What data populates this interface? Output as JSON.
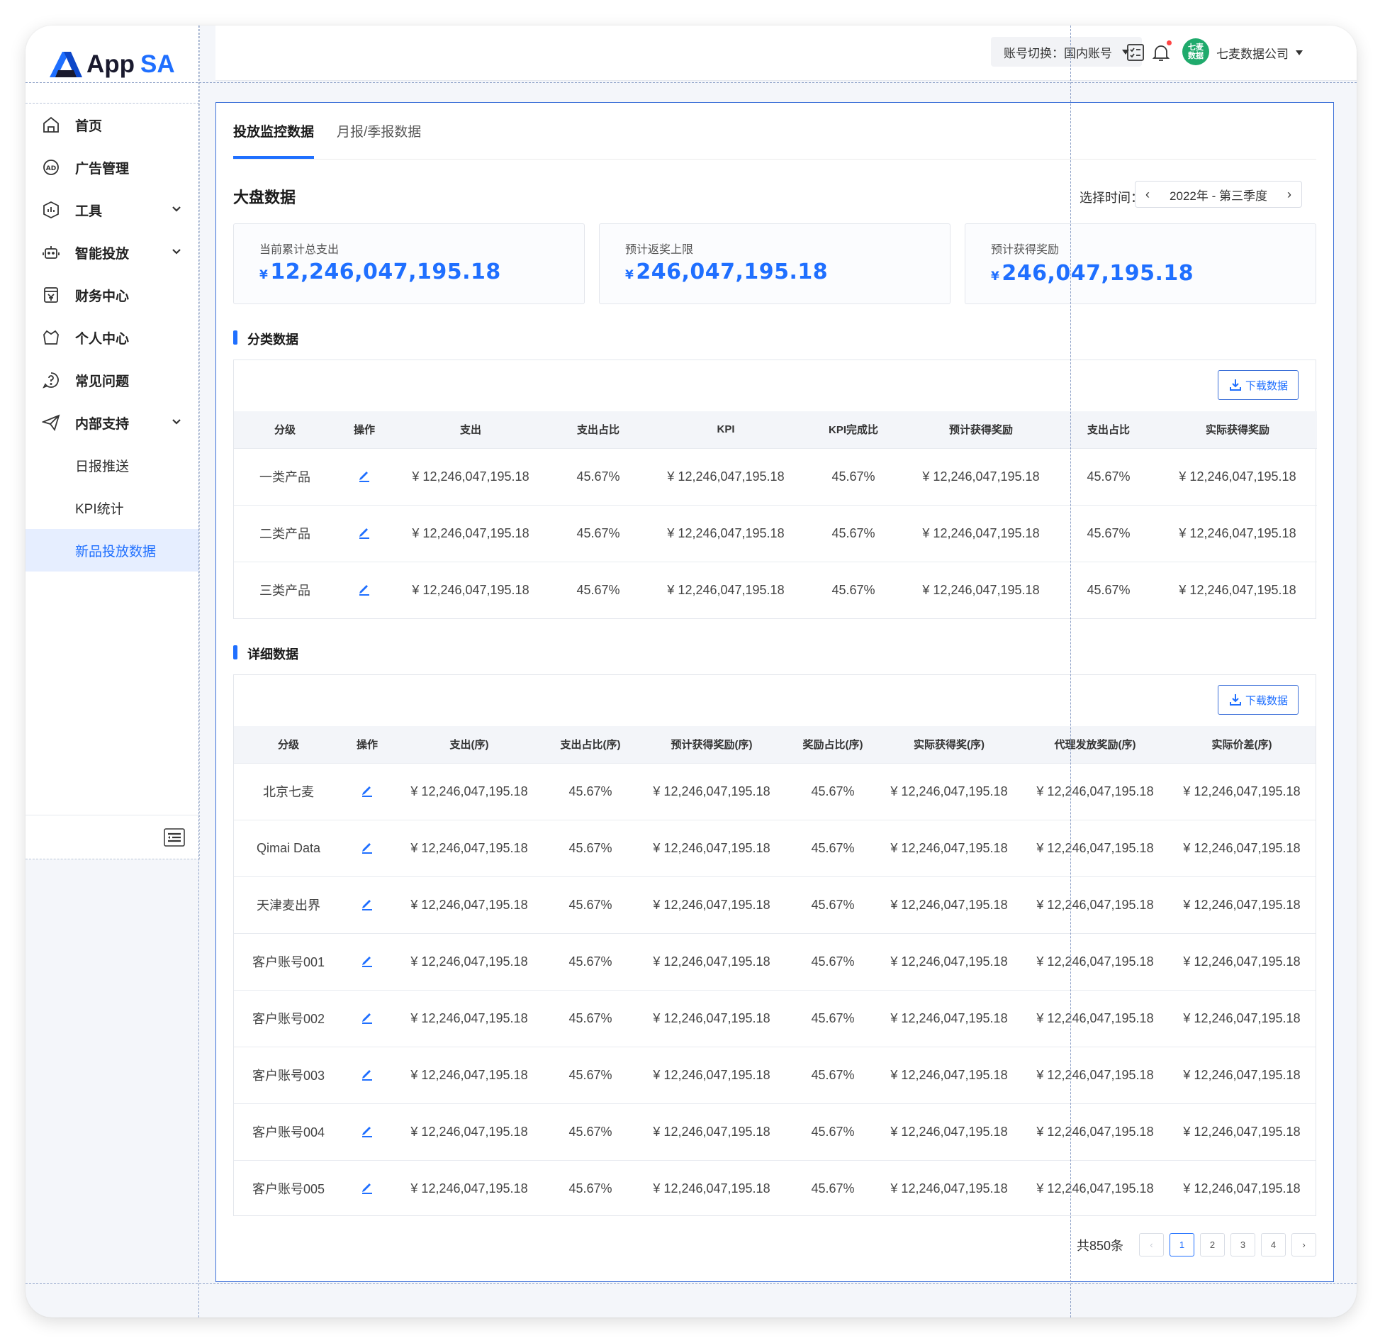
{
  "logo": {
    "app": "App",
    "sa": "SA"
  },
  "sidebar": {
    "items": [
      {
        "label": "首页",
        "icon": "home-icon"
      },
      {
        "label": "广告管理",
        "icon": "ad-icon"
      },
      {
        "label": "工具",
        "icon": "tools-icon",
        "expandable": true
      },
      {
        "label": "智能投放",
        "icon": "robot-icon",
        "expandable": true
      },
      {
        "label": "财务中心",
        "icon": "finance-icon"
      },
      {
        "label": "个人中心",
        "icon": "basket-icon"
      },
      {
        "label": "常见问题",
        "icon": "question-icon"
      },
      {
        "label": "内部支持",
        "icon": "send-icon",
        "expandable": true
      }
    ],
    "sub_items": [
      {
        "label": "日报推送"
      },
      {
        "label": "KPI统计"
      },
      {
        "label": "新品投放数据",
        "active": true
      }
    ]
  },
  "topbar": {
    "account_switch": "账号切换：国内账号",
    "avatar_text": "七麦数据",
    "company": "七麦数据公司"
  },
  "tabs": [
    {
      "label": "投放监控数据",
      "active": true
    },
    {
      "label": "月报/季报数据",
      "active": false
    }
  ],
  "overview": {
    "title": "大盘数据",
    "time_label": "选择时间：",
    "time_value": "2022年 - 第三季度",
    "stats": [
      {
        "label": "当前累计总支出",
        "currency": "¥",
        "value": "12,246,047,195.18"
      },
      {
        "label": "预计返奖上限",
        "currency": "¥",
        "value": "246,047,195.18"
      },
      {
        "label": "预计获得奖励",
        "currency": "¥",
        "value": "246,047,195.18"
      }
    ]
  },
  "category": {
    "title": "分类数据",
    "download": "下载数据",
    "columns": [
      "分级",
      "操作",
      "支出",
      "支出占比",
      "KPI",
      "KPI完成比",
      "预计获得奖励",
      "支出占比",
      "实际获得奖励"
    ],
    "rows": [
      [
        "一类产品",
        "¥ 12,246,047,195.18",
        "45.67%",
        "¥ 12,246,047,195.18",
        "45.67%",
        "¥ 12,246,047,195.18",
        "45.67%",
        "¥ 12,246,047,195.18"
      ],
      [
        "二类产品",
        "¥ 12,246,047,195.18",
        "45.67%",
        "¥ 12,246,047,195.18",
        "45.67%",
        "¥ 12,246,047,195.18",
        "45.67%",
        "¥ 12,246,047,195.18"
      ],
      [
        "三类产品",
        "¥ 12,246,047,195.18",
        "45.67%",
        "¥ 12,246,047,195.18",
        "45.67%",
        "¥ 12,246,047,195.18",
        "45.67%",
        "¥ 12,246,047,195.18"
      ]
    ]
  },
  "detail": {
    "title": "详细数据",
    "download": "下载数据",
    "columns": [
      "分级",
      "操作",
      "支出(序)",
      "支出占比(序)",
      "预计获得奖励(序)",
      "奖励占比(序)",
      "实际获得奖(序)",
      "代理发放奖励(序)",
      "实际价差(序)"
    ],
    "rows": [
      [
        "北京七麦",
        "¥ 12,246,047,195.18",
        "45.67%",
        "¥ 12,246,047,195.18",
        "45.67%",
        "¥ 12,246,047,195.18",
        "¥ 12,246,047,195.18",
        "¥ 12,246,047,195.18"
      ],
      [
        "Qimai Data",
        "¥ 12,246,047,195.18",
        "45.67%",
        "¥ 12,246,047,195.18",
        "45.67%",
        "¥ 12,246,047,195.18",
        "¥ 12,246,047,195.18",
        "¥ 12,246,047,195.18"
      ],
      [
        "天津麦出界",
        "¥ 12,246,047,195.18",
        "45.67%",
        "¥ 12,246,047,195.18",
        "45.67%",
        "¥ 12,246,047,195.18",
        "¥ 12,246,047,195.18",
        "¥ 12,246,047,195.18"
      ],
      [
        "客户账号001",
        "¥ 12,246,047,195.18",
        "45.67%",
        "¥ 12,246,047,195.18",
        "45.67%",
        "¥ 12,246,047,195.18",
        "¥ 12,246,047,195.18",
        "¥ 12,246,047,195.18"
      ],
      [
        "客户账号002",
        "¥ 12,246,047,195.18",
        "45.67%",
        "¥ 12,246,047,195.18",
        "45.67%",
        "¥ 12,246,047,195.18",
        "¥ 12,246,047,195.18",
        "¥ 12,246,047,195.18"
      ],
      [
        "客户账号003",
        "¥ 12,246,047,195.18",
        "45.67%",
        "¥ 12,246,047,195.18",
        "45.67%",
        "¥ 12,246,047,195.18",
        "¥ 12,246,047,195.18",
        "¥ 12,246,047,195.18"
      ],
      [
        "客户账号004",
        "¥ 12,246,047,195.18",
        "45.67%",
        "¥ 12,246,047,195.18",
        "45.67%",
        "¥ 12,246,047,195.18",
        "¥ 12,246,047,195.18",
        "¥ 12,246,047,195.18"
      ],
      [
        "客户账号005",
        "¥ 12,246,047,195.18",
        "45.67%",
        "¥ 12,246,047,195.18",
        "45.67%",
        "¥ 12,246,047,195.18",
        "¥ 12,246,047,195.18",
        "¥ 12,246,047,195.18"
      ]
    ]
  },
  "pagination": {
    "total": "共850条",
    "pages": [
      "1",
      "2",
      "3",
      "4"
    ],
    "current": "1",
    "prev": "‹",
    "next": "›"
  },
  "colors": {
    "accent": "#1f6fff",
    "avatar": "#1faa6c",
    "badge": "#ff4444"
  }
}
